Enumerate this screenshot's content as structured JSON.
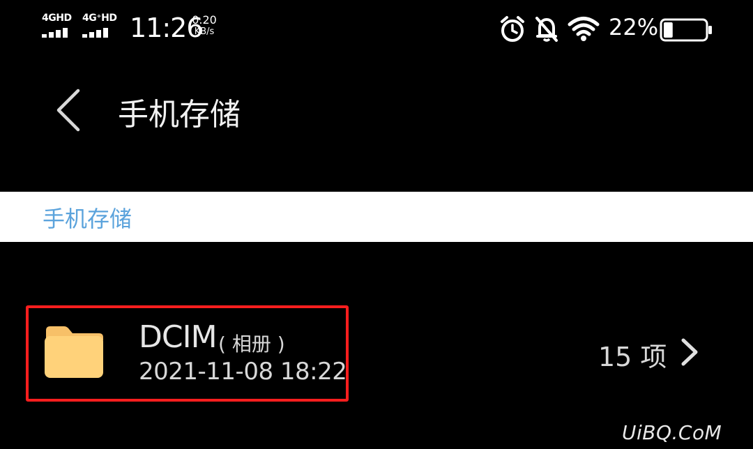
{
  "status_bar": {
    "network_1": "4GHD",
    "network_2": "4G⁺HD",
    "time": "11:26",
    "speed_value": "0.20",
    "speed_unit": "KB/s",
    "battery_percent": "22%",
    "battery_level": 0.22,
    "icons": [
      "alarm-icon",
      "mute-bell-icon",
      "wifi-icon",
      "battery-icon"
    ]
  },
  "header": {
    "title": "手机存储",
    "back_icon": "back-chevron-icon"
  },
  "breadcrumb": {
    "label": "手机存储",
    "color": "#5ba3dc"
  },
  "file_list": [
    {
      "name": "DCIM",
      "tag": "( 相册 )",
      "modified": "2021-11-08 18:22",
      "count": "15 项",
      "icon": "folder-icon",
      "icon_color": "#ffd27a"
    }
  ],
  "highlight_color": "#ff1e1e",
  "watermark": "UiBQ.CoM"
}
